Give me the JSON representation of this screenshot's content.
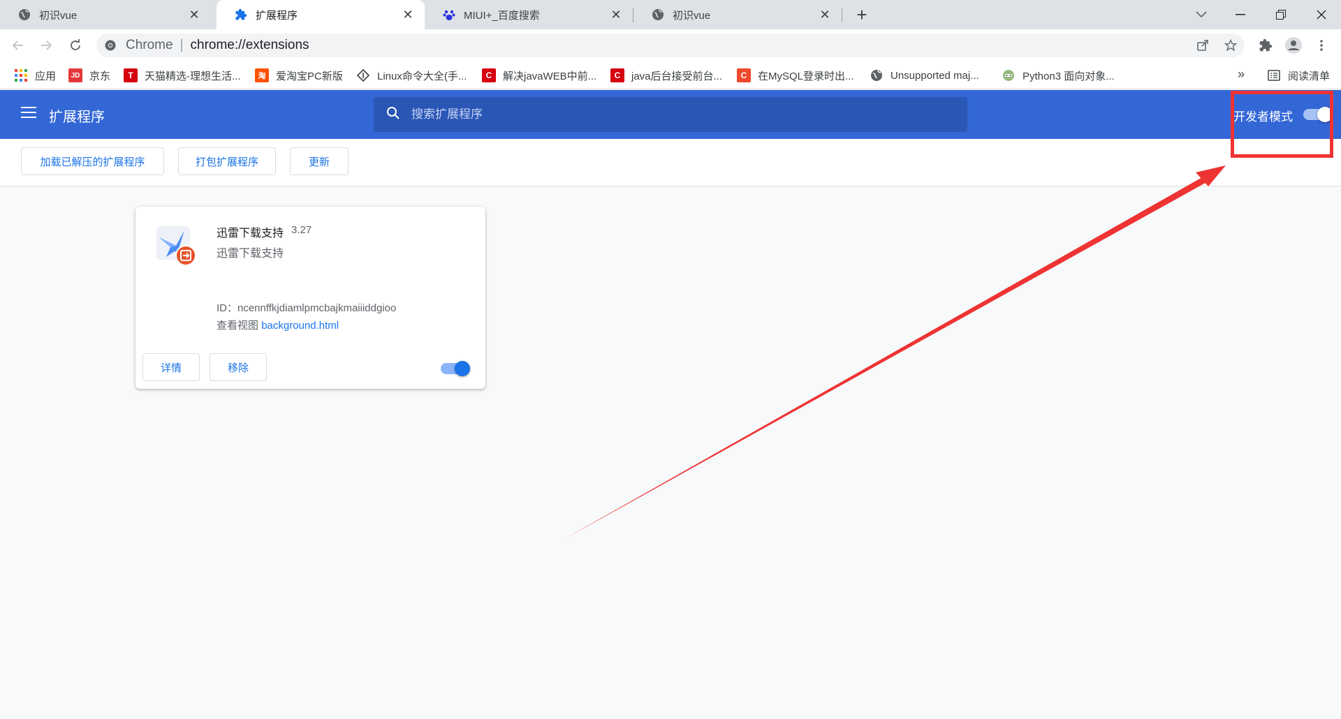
{
  "tabs": [
    {
      "title": "初识vue",
      "icon": "globe-icon",
      "active": false
    },
    {
      "title": "扩展程序",
      "icon": "puzzle-icon",
      "active": true
    },
    {
      "title": "MIUI+_百度搜索",
      "icon": "baidu-paw-icon",
      "active": false
    },
    {
      "title": "初识vue",
      "icon": "globe-icon",
      "active": false
    }
  ],
  "omnibox": {
    "scheme": "Chrome",
    "separator": "|",
    "url": "chrome://extensions"
  },
  "bookmarks": [
    {
      "label": "应用",
      "icon": "apps-grid-icon"
    },
    {
      "label": "京东",
      "icon": "jd-icon",
      "glyph": "JD",
      "color": "#e4393c"
    },
    {
      "label": "天猫精选-理想生活...",
      "icon": "tmall-icon",
      "glyph": "T",
      "color": "#d4000f"
    },
    {
      "label": "爱淘宝PC新版",
      "icon": "taobao-icon",
      "glyph": "淘",
      "color": "#ff5000"
    },
    {
      "label": "Linux命令大全(手...",
      "icon": "linux-icon"
    },
    {
      "label": "解决javaWEB中前...",
      "icon": "csdn-icon",
      "glyph": "C",
      "color": "#d6000f"
    },
    {
      "label": "java后台接受前台...",
      "icon": "csdn-icon",
      "glyph": "C",
      "color": "#d6000f"
    },
    {
      "label": "在MySQL登录时出...",
      "icon": "csdn-icon",
      "glyph": "C",
      "color": "#f0492b"
    },
    {
      "label": "Unsupported maj...",
      "icon": "globe-icon"
    },
    {
      "label": "Python3 面向对象...",
      "icon": "runoob-icon"
    }
  ],
  "reading_list": {
    "label": "阅读清单",
    "icon": "reading-list-icon"
  },
  "header": {
    "title": "扩展程序",
    "search_placeholder": "搜索扩展程序",
    "dev_mode_label": "开发者模式",
    "dev_mode_on": true
  },
  "actions": {
    "load_unpacked": "加载已解压的扩展程序",
    "pack": "打包扩展程序",
    "update": "更新"
  },
  "extension": {
    "name": "迅雷下载支持",
    "version": "3.27",
    "description": "迅雷下载支持",
    "id_text": "ID：ncennffkjdiamlpmcbajkmaiiiddgioo",
    "inspect_label": "查看视图",
    "inspect_link": "background.html",
    "details_label": "详情",
    "remove_label": "移除",
    "enabled": true
  },
  "colors": {
    "accent": "#3367d6",
    "link": "#1a73e8",
    "annotation": "#ee3333"
  }
}
